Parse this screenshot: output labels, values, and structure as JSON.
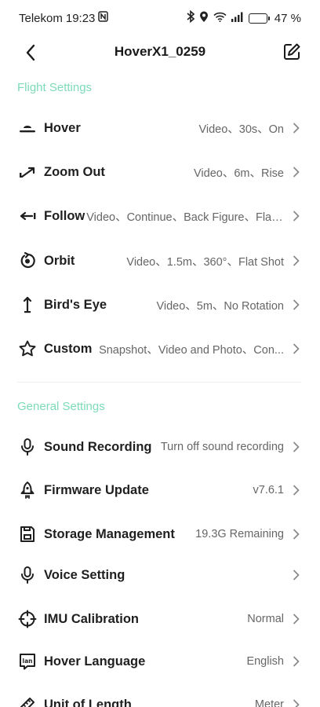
{
  "status_bar": {
    "carrier": "Telekom",
    "time": "19:23",
    "battery_percent": "47 %",
    "battery_level": 0.47,
    "icons": [
      "nfc-icon",
      "bluetooth-icon",
      "location-icon",
      "wifi-icon",
      "signal-icon",
      "battery-icon"
    ]
  },
  "header": {
    "title": "HoverX1_0259",
    "back_icon": "back-chevron-icon",
    "edit_icon": "edit-icon"
  },
  "flight_settings": {
    "title": "Flight Settings",
    "items": [
      {
        "icon": "hover-icon",
        "label": "Hover",
        "value": "Video、30s、On"
      },
      {
        "icon": "zoom-out-icon",
        "label": "Zoom Out",
        "value": "Video、6m、Rise"
      },
      {
        "icon": "follow-icon",
        "label": "Follow",
        "value": "Video、Continue、Back Figure、Flat ..."
      },
      {
        "icon": "orbit-icon",
        "label": "Orbit",
        "value": "Video、1.5m、360°、Flat Shot"
      },
      {
        "icon": "birds-eye-icon",
        "label": "Bird's Eye",
        "value": "Video、5m、No Rotation"
      },
      {
        "icon": "custom-star-icon",
        "label": "Custom",
        "value": "Snapshot、Video and Photo、Con..."
      }
    ]
  },
  "general_settings": {
    "title": "General Settings",
    "items": [
      {
        "icon": "microphone-icon",
        "label": "Sound Recording",
        "value": "Turn off sound recording"
      },
      {
        "icon": "rocket-icon",
        "label": "Firmware Update",
        "value": "v7.6.1"
      },
      {
        "icon": "storage-icon",
        "label": "Storage Management",
        "value": "19.3G Remaining"
      },
      {
        "icon": "microphone-icon",
        "label": "Voice Setting",
        "value": ""
      },
      {
        "icon": "crosshair-icon",
        "label": "IMU Calibration",
        "value": "Normal"
      },
      {
        "icon": "language-icon",
        "label": "Hover Language",
        "value": "English"
      },
      {
        "icon": "ruler-icon",
        "label": "Unit of Length",
        "value": "Meter"
      }
    ],
    "language_icon_text": "lan"
  },
  "colors": {
    "section_title": "#7ddbb8",
    "label": "#1f1f1f",
    "value": "#666666",
    "chevron": "#8a8a8a"
  }
}
